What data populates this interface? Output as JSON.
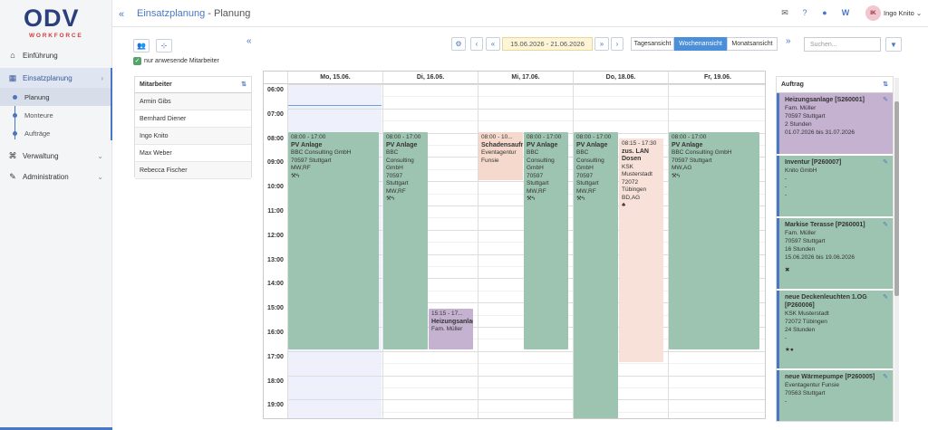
{
  "brand": {
    "logo": "ODV",
    "sub": "WORKFORCE"
  },
  "sidebar": {
    "items": [
      {
        "label": "Einführung",
        "icon": "home-icon"
      },
      {
        "label": "Einsatzplanung",
        "icon": "calendar-icon"
      },
      {
        "label": "Verwaltung",
        "icon": "bank-icon"
      },
      {
        "label": "Administration",
        "icon": "wrench-icon"
      }
    ],
    "subitems": [
      "Planung",
      "Monteure",
      "Aufträge"
    ]
  },
  "header": {
    "section": "Einsatzplanung",
    "separator": " - ",
    "page": "Planung",
    "user_initials": "IK",
    "user_name": "Ingo Knito"
  },
  "toolbar": {
    "date_range": "15.06.2026 - 21.06.2026",
    "views": [
      "Tagesansicht",
      "Wochenansicht",
      "Monatsansicht"
    ],
    "active_view": "Wochenansicht",
    "search_placeholder": "Suchen...",
    "only_present_label": "nur anwesende Mitarbeiter"
  },
  "employees": {
    "header": "Mitarbeiter",
    "list": [
      "Armin Gibs",
      "Bernhard Diener",
      "Ingo Knito",
      "Max Weber",
      "Rebecca Fischer"
    ]
  },
  "calendar": {
    "days": [
      "Mo, 15.06.",
      "Di, 16.06.",
      "Mi, 17.06.",
      "Do, 18.06.",
      "Fr, 19.06."
    ],
    "hours": [
      "06:00",
      "07:00",
      "08:00",
      "09:00",
      "10:00",
      "11:00",
      "12:00",
      "13:00",
      "14:00",
      "15:00",
      "16:00",
      "17:00",
      "18:00",
      "19:00"
    ],
    "events": [
      {
        "time": "08:00 - 17:00",
        "title": "PV Anlage",
        "lines": [
          "BBC Consulting GmbH",
          "70597 Stuttgart",
          "MW,RF"
        ],
        "icons": "⚒ϟ"
      },
      {
        "time": "08:00 - 17:00",
        "title": "PV Anlage",
        "lines": [
          "BBC",
          "Consulting",
          "GmbH",
          "70597",
          "Stuttgart",
          "MW,RF"
        ],
        "icons": "⚒ϟ"
      },
      {
        "time": "15:15 - 17...",
        "title": "Heizungsanlage",
        "lines": [
          "Fam. Müller"
        ],
        "icons": ""
      },
      {
        "time": "08:00 - 10...",
        "title": "Schadensaufnahme",
        "lines": [
          "Eventagentur",
          "Funsie"
        ],
        "icons": ""
      },
      {
        "time": "08:00 - 17:00",
        "title": "PV Anlage",
        "lines": [
          "BBC",
          "Consulting",
          "GmbH",
          "70597",
          "Stuttgart",
          "MW,RF"
        ],
        "icons": "⚒ϟ"
      },
      {
        "time": "08:00 - 17:00",
        "title": "PV Anlage",
        "lines": [
          "BBC",
          "Consulting",
          "GmbH",
          "70597",
          "Stuttgart",
          "MW,RF"
        ],
        "icons": "⚒ϟ"
      },
      {
        "time": "08:15 - 17:30",
        "title": "zus. LAN Dosen",
        "lines": [
          "KSK",
          "Musterstadt",
          "72072",
          "Tübingen",
          "BD,AG"
        ],
        "icons": "♣"
      },
      {
        "time": "08:00 - 17:00",
        "title": "PV Anlage",
        "lines": [
          "BBC Consulting GmbH",
          "70597 Stuttgart",
          "MW,AG"
        ],
        "icons": "⚒ϟ"
      }
    ]
  },
  "orders": {
    "header": "Auftrag",
    "list": [
      {
        "title": "Heizungsanlage [S260001]",
        "lines": [
          "Fam. Müller",
          "70597 Stuttgart",
          "2 Stunden",
          "01.07.2026 bis 31.07.2026"
        ],
        "icons": ""
      },
      {
        "title": "Inventur [P260007]",
        "lines": [
          "Knito GmbH",
          "-",
          "-",
          "-"
        ],
        "icons": ""
      },
      {
        "title": "Markise Terasse [P260001]",
        "lines": [
          "Fam. Müller",
          "70597 Stuttgart",
          "16 Stunden",
          "15.06.2026 bis 19.06.2026"
        ],
        "icons": "✖"
      },
      {
        "title": "neue Deckenleuchten 1.OG [P260006]",
        "lines": [
          "KSK Musterstadt",
          "72072 Tübingen",
          "24 Stunden",
          "-"
        ],
        "icons": "★●"
      },
      {
        "title": "neue Wärmepumpe [P260005]",
        "lines": [
          "Eventagentur Funsie",
          "70563 Stuttgart",
          "-"
        ],
        "icons": ""
      }
    ]
  },
  "colors": {
    "accent": "#4a77c3",
    "green": "#9dc4b0",
    "purple": "#c5b1d0",
    "salmon": "#f5d9cc"
  }
}
